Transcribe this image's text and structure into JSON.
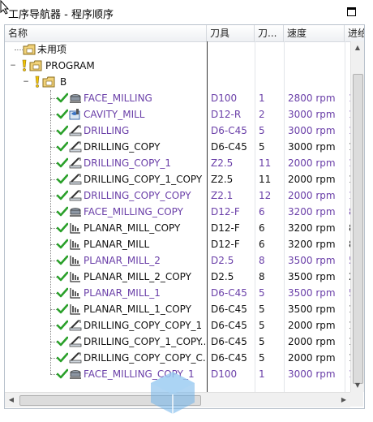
{
  "window": {
    "title": "工序导航器 - 程序顺序"
  },
  "columns": {
    "name": "名称",
    "tool": "刀具",
    "tool_no": "刀...",
    "speed": "速度",
    "feed": "进给"
  },
  "colors": {
    "normal_text": "#111111",
    "purple_text": "#6a3fa8",
    "check_green": "#2aa02a"
  },
  "tree": {
    "unused": "未用项",
    "program": "PROGRAM",
    "group_b": "B"
  },
  "operations": [
    {
      "name": "FACE_MILLING",
      "tool": "D100",
      "num": "1",
      "speed": "2800 rpm",
      "feed": "1",
      "style": "purple",
      "icon": "face-milling-icon"
    },
    {
      "name": "CAVITY_MILL",
      "tool": "D12-R",
      "num": "2",
      "speed": "3000 rpm",
      "feed": "1",
      "style": "purple",
      "icon": "cavity-mill-icon"
    },
    {
      "name": "DRILLING",
      "tool": "D6-C45",
      "num": "5",
      "speed": "3000 rpm",
      "feed": "1",
      "style": "purple",
      "icon": "drilling-icon"
    },
    {
      "name": "DRILLING_COPY",
      "tool": "D6-C45",
      "num": "5",
      "speed": "3000 rpm",
      "feed": "1",
      "style": "normal",
      "icon": "drilling-icon"
    },
    {
      "name": "DRILLING_COPY_1",
      "tool": "Z2.5",
      "num": "11",
      "speed": "2000 rpm",
      "feed": "1",
      "style": "purple",
      "icon": "drilling-icon"
    },
    {
      "name": "DRILLING_COPY_1_COPY",
      "tool": "Z2.5",
      "num": "11",
      "speed": "2000 rpm",
      "feed": "1",
      "style": "normal",
      "icon": "drilling-icon"
    },
    {
      "name": "DRILLING_COPY_COPY",
      "tool": "Z2.1",
      "num": "12",
      "speed": "2000 rpm",
      "feed": "1",
      "style": "purple",
      "icon": "drilling-icon"
    },
    {
      "name": "FACE_MILLING_COPY",
      "tool": "D12-F",
      "num": "6",
      "speed": "3200 rpm",
      "feed": "8",
      "style": "purple",
      "icon": "face-milling-icon"
    },
    {
      "name": "PLANAR_MILL_COPY",
      "tool": "D12-F",
      "num": "6",
      "speed": "3200 rpm",
      "feed": "8",
      "style": "normal",
      "icon": "planar-mill-icon"
    },
    {
      "name": "PLANAR_MILL",
      "tool": "D12-F",
      "num": "6",
      "speed": "3200 rpm",
      "feed": "8",
      "style": "normal",
      "icon": "planar-mill-icon"
    },
    {
      "name": "PLANAR_MILL_2",
      "tool": "D2.5",
      "num": "8",
      "speed": "3500 rpm",
      "feed": "5",
      "style": "purple",
      "icon": "planar-mill-icon"
    },
    {
      "name": "PLANAR_MILL_2_COPY",
      "tool": "D2.5",
      "num": "8",
      "speed": "3500 rpm",
      "feed": "2",
      "style": "normal",
      "icon": "planar-mill-icon"
    },
    {
      "name": "PLANAR_MILL_1",
      "tool": "D6-C45",
      "num": "5",
      "speed": "3500 rpm",
      "feed": "5",
      "style": "purple",
      "icon": "planar-mill-icon"
    },
    {
      "name": "PLANAR_MILL_1_COPY",
      "tool": "D6-C45",
      "num": "5",
      "speed": "3500 rpm",
      "feed": "1",
      "style": "normal",
      "icon": "planar-mill-icon"
    },
    {
      "name": "DRILLING_COPY_COPY_1",
      "tool": "D6-C45",
      "num": "5",
      "speed": "2000 rpm",
      "feed": "1",
      "style": "normal",
      "icon": "drilling-icon"
    },
    {
      "name": "DRILLING_COPY_1_COPY...",
      "tool": "D6-C45",
      "num": "5",
      "speed": "2000 rpm",
      "feed": "1",
      "style": "normal",
      "icon": "drilling-icon"
    },
    {
      "name": "DRILLING_COPY_COPY_C...",
      "tool": "D6-C45",
      "num": "5",
      "speed": "2000 rpm",
      "feed": "1",
      "style": "normal",
      "icon": "drilling-icon"
    },
    {
      "name": "FACE_MILLING_COPY_1",
      "tool": "D100",
      "num": "1",
      "speed": "3000 rpm",
      "feed": "1",
      "style": "purple",
      "icon": "face-milling-icon"
    }
  ]
}
